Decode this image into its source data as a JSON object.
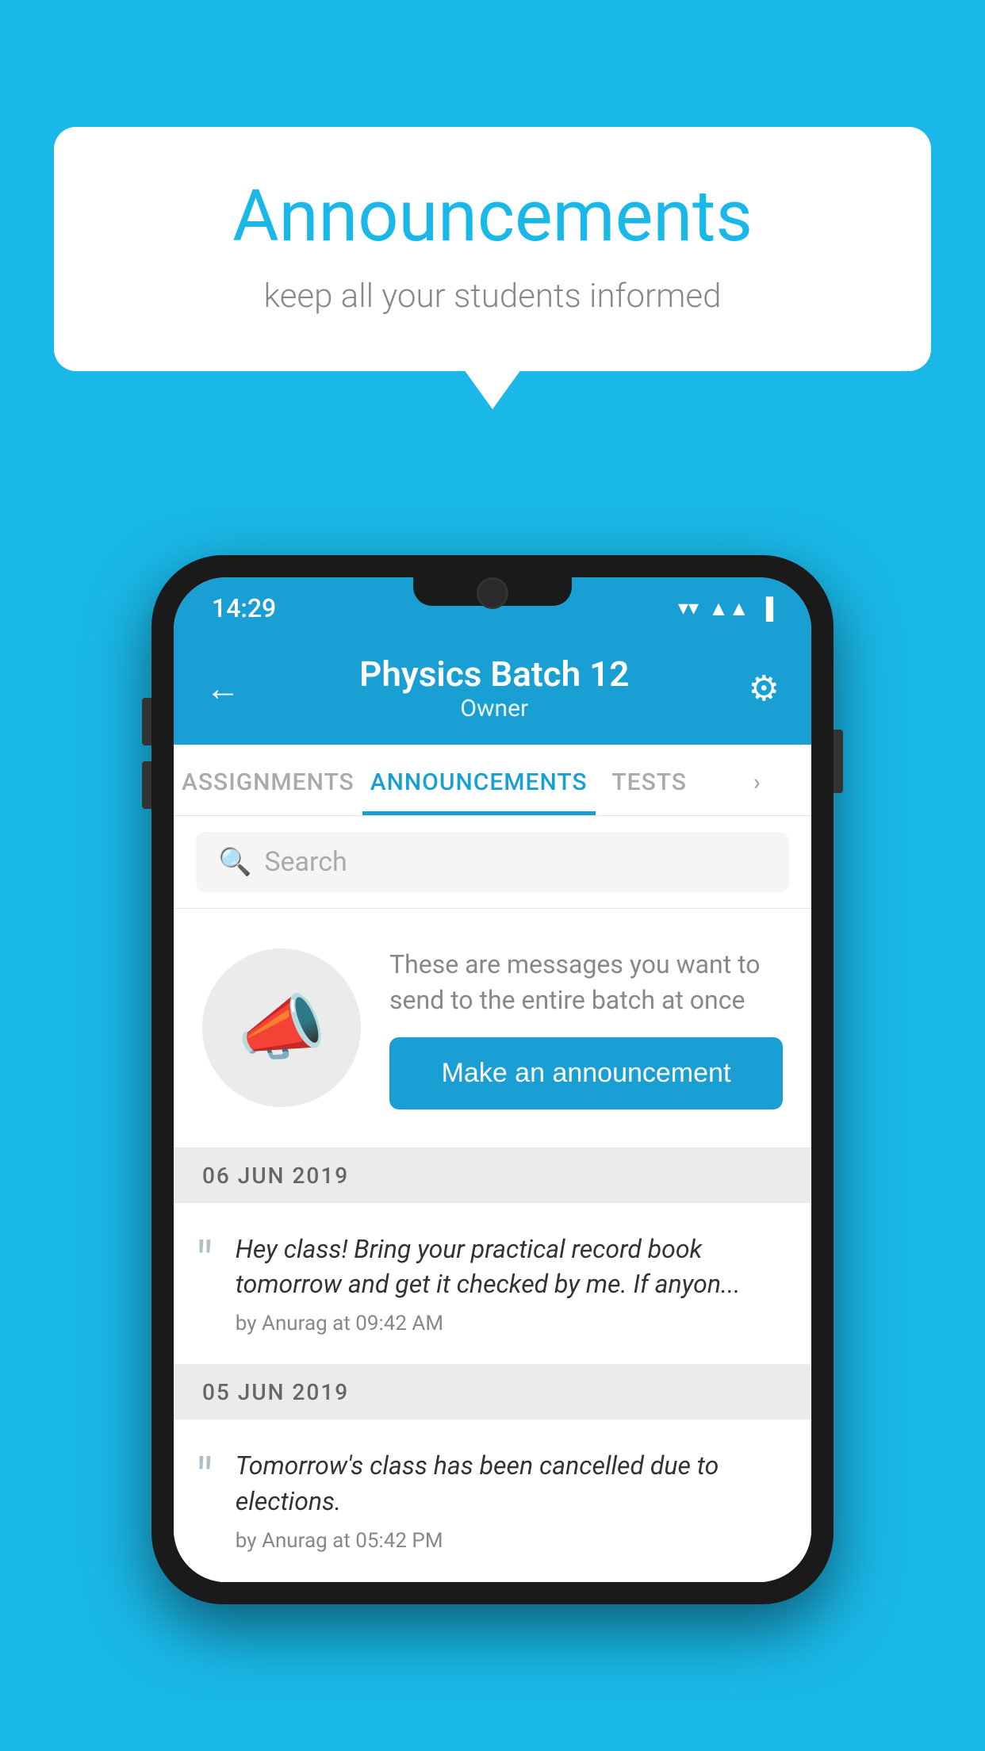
{
  "page": {
    "background_color": "#1ab8e8"
  },
  "speech_bubble": {
    "title": "Announcements",
    "subtitle": "keep all your students informed"
  },
  "phone": {
    "status_bar": {
      "time": "14:29",
      "icons": [
        "wifi",
        "signal",
        "battery"
      ]
    },
    "header": {
      "title": "Physics Batch 12",
      "subtitle": "Owner",
      "back_label": "←",
      "gear_label": "⚙"
    },
    "tabs": [
      {
        "label": "ASSIGNMENTS",
        "active": false
      },
      {
        "label": "ANNOUNCEMENTS",
        "active": true
      },
      {
        "label": "TESTS",
        "active": false
      },
      {
        "label": "›",
        "active": false
      }
    ],
    "search": {
      "placeholder": "Search"
    },
    "announcement_prompt": {
      "description": "These are messages you want to send to the entire batch at once",
      "button_label": "Make an announcement"
    },
    "announcements": [
      {
        "date": "06  JUN  2019",
        "text": "Hey class! Bring your practical record book tomorrow and get it checked by me. If anyon...",
        "meta": "by Anurag at 09:42 AM"
      },
      {
        "date": "05  JUN  2019",
        "text": "Tomorrow's class has been cancelled due to elections.",
        "meta": "by Anurag at 05:42 PM"
      }
    ]
  }
}
